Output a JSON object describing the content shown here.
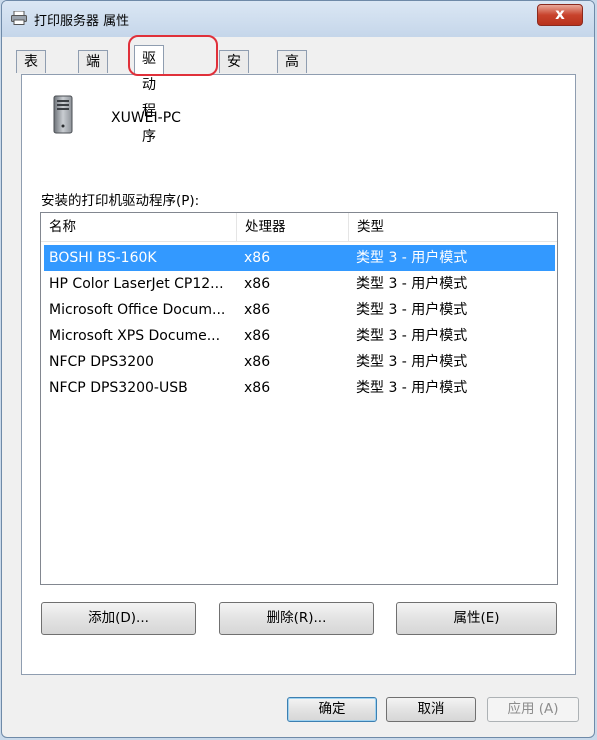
{
  "window": {
    "title": "打印服务器 属性",
    "close_label": "x"
  },
  "tabs": [
    "表单",
    "端口",
    "驱动程序",
    "安全",
    "高级"
  ],
  "active_tab": "驱动程序",
  "server": {
    "name": "XUWEI-PC"
  },
  "drivers_label": "安装的打印机驱动程序(P):",
  "columns": [
    "名称",
    "处理器",
    "类型"
  ],
  "drivers": [
    {
      "name": "BOSHI BS-160K",
      "processor": "x86",
      "type": "类型 3 - 用户模式",
      "selected": true
    },
    {
      "name": "HP Color LaserJet CP12...",
      "processor": "x86",
      "type": "类型 3 - 用户模式"
    },
    {
      "name": "Microsoft Office Docum...",
      "processor": "x86",
      "type": "类型 3 - 用户模式"
    },
    {
      "name": "Microsoft XPS Docume...",
      "processor": "x86",
      "type": "类型 3 - 用户模式"
    },
    {
      "name": "NFCP DPS3200",
      "processor": "x86",
      "type": "类型 3 - 用户模式"
    },
    {
      "name": "NFCP DPS3200-USB",
      "processor": "x86",
      "type": "类型 3 - 用户模式"
    }
  ],
  "panel_buttons": {
    "add": "添加(D)...",
    "delete": "删除(R)...",
    "properties": "属性(E)"
  },
  "dialog_buttons": {
    "ok": "确定",
    "cancel": "取消",
    "apply": "应用 (A)"
  },
  "colors": {
    "selection": "#3399ff",
    "highlight_ring": "#e0303a",
    "close_button": "#c8432c"
  }
}
